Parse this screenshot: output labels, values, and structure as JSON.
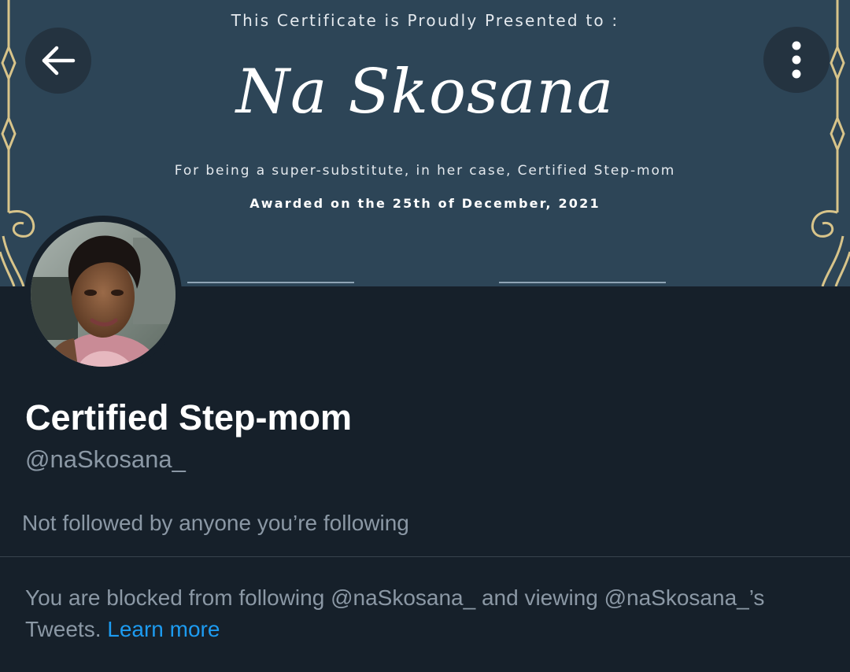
{
  "banner": {
    "presented_to": "This Certificate is Proudly Presented to :",
    "recipient_name": "Na Skosana",
    "reason": "For being a super-substitute, in her case, Certified Step-mom",
    "awarded": "Awarded on the 25th of December, 2021"
  },
  "header": {
    "back_icon": "arrow-left-icon",
    "more_icon": "more-vertical-icon"
  },
  "profile": {
    "display_name": "Certified Step-mom",
    "handle": "@naSkosana_",
    "followed_by": "Not followed by anyone you’re following"
  },
  "blocked": {
    "text": "You are blocked from following @naSkosana_ and viewing @naSkosana_’s Tweets.",
    "link_label": "Learn more"
  },
  "colors": {
    "background": "#16202a",
    "banner": "#2d4557",
    "gold": "#d8c48a",
    "link": "#1d9bf0",
    "muted_text": "#8b98a5"
  }
}
